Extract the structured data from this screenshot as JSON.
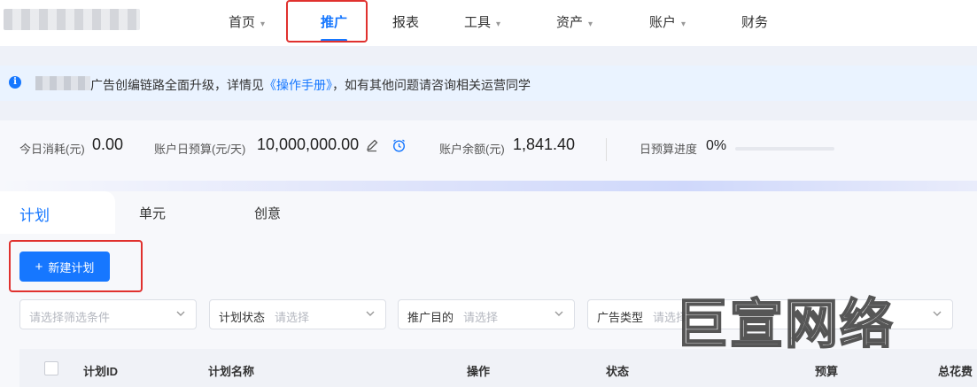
{
  "nav": {
    "items": [
      {
        "label": "首页",
        "caret": "▾"
      },
      {
        "label": "推广",
        "caret": ""
      },
      {
        "label": "报表",
        "caret": ""
      },
      {
        "label": "工具",
        "caret": "▾"
      },
      {
        "label": "资产",
        "caret": "▾"
      },
      {
        "label": "账户",
        "caret": "▾"
      },
      {
        "label": "财务",
        "caret": ""
      }
    ],
    "active": "推广"
  },
  "notice": {
    "icon": "info-icon",
    "text_before": "广告创编链路全面升级，详情见",
    "link": "《操作手册》",
    "text_after": "，如有其他问题请咨询相关运营同学"
  },
  "stats": {
    "today_spend_label": "今日消耗(元)",
    "today_spend_value": "0.00",
    "daily_budget_label": "账户日预算(元/天)",
    "daily_budget_value": "10,000,000.00",
    "balance_label": "账户余额(元)",
    "balance_value": "1,841.40",
    "budget_progress_label": "日预算进度",
    "budget_progress_value": "0%",
    "budget_progress_fraction": 0
  },
  "tabs": [
    "计划",
    "单元",
    "创意"
  ],
  "active_tab": "计划",
  "new_plan_button": "新建计划",
  "filters": [
    {
      "label": "",
      "placeholder": "请选择筛选条件"
    },
    {
      "label": "计划状态",
      "placeholder": "请选择"
    },
    {
      "label": "推广目的",
      "placeholder": "请选择"
    },
    {
      "label": "广告类型",
      "placeholder": "请选择"
    }
  ],
  "table_headers": [
    "计划ID",
    "计划名称",
    "操作",
    "状态",
    "预算",
    "总花费"
  ],
  "watermark": "巨宣网络",
  "colors": {
    "accent": "#1677ff",
    "highlight": "#e0312e"
  }
}
